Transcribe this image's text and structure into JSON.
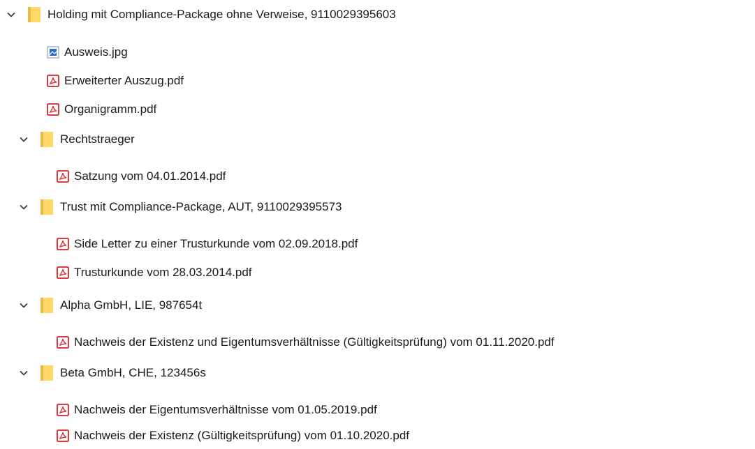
{
  "tree": {
    "root": {
      "label": "Holding mit Compliance-Package ohne Verweise, 9110029395603",
      "icon": "folder-icon",
      "expanded": true,
      "files": [
        {
          "label": "Ausweis.jpg",
          "icon": "image-file-icon"
        },
        {
          "label": "Erweiterter Auszug.pdf",
          "icon": "pdf-file-icon"
        },
        {
          "label": "Organigramm.pdf",
          "icon": "pdf-file-icon"
        }
      ],
      "folders": [
        {
          "label": "Rechtstraeger",
          "icon": "folder-icon",
          "expanded": true,
          "files": [
            {
              "label": "Satzung vom 04.01.2014.pdf",
              "icon": "pdf-file-icon"
            }
          ]
        },
        {
          "label": "Trust mit Compliance-Package, AUT, 9110029395573",
          "icon": "folder-icon",
          "expanded": true,
          "files": [
            {
              "label": "Side Letter zu einer Trusturkunde vom 02.09.2018.pdf",
              "icon": "pdf-file-icon"
            },
            {
              "label": "Trusturkunde vom 28.03.2014.pdf",
              "icon": "pdf-file-icon"
            }
          ]
        },
        {
          "label": "Alpha GmbH, LIE, 987654t",
          "icon": "folder-icon",
          "expanded": true,
          "files": [
            {
              "label": "Nachweis der Existenz und Eigentumsverhältnisse  (Gültigkeitsprüfung) vom 01.11.2020.pdf",
              "icon": "pdf-file-icon"
            }
          ]
        },
        {
          "label": "Beta GmbH, CHE, 123456s",
          "icon": "folder-icon",
          "expanded": true,
          "files": [
            {
              "label": "Nachweis der Eigentumsverhältnisse vom 01.05.2019.pdf",
              "icon": "pdf-file-icon"
            },
            {
              "label": "Nachweis der Existenz  (Gültigkeitsprüfung) vom 01.10.2020.pdf",
              "icon": "pdf-file-icon"
            }
          ]
        }
      ]
    }
  },
  "colors": {
    "folder": "#FFD868",
    "folder_tab": "#E8B84A",
    "pdf_red": "#D9222A",
    "image_blue": "#2B6CC4",
    "chevron": "#333333",
    "text": "#1A1A1A"
  }
}
